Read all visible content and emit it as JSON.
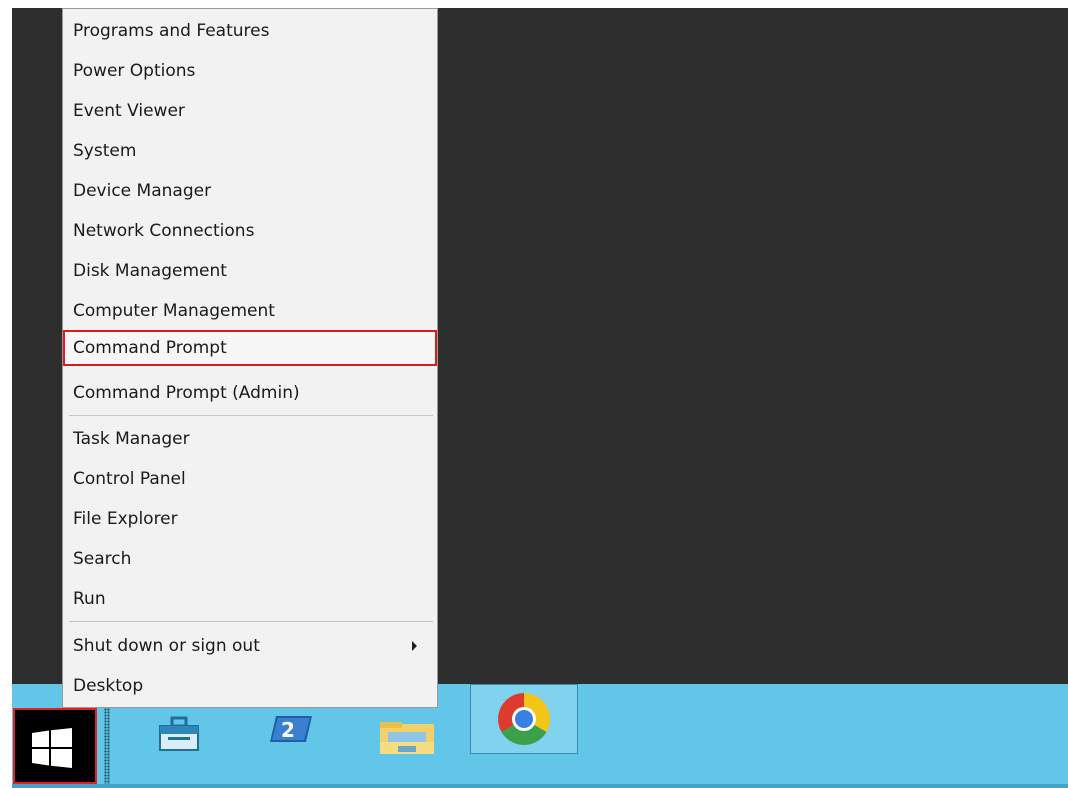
{
  "context_menu": {
    "items": [
      {
        "label": "Programs and Features"
      },
      {
        "label": "Power Options"
      },
      {
        "label": "Event Viewer"
      },
      {
        "label": "System"
      },
      {
        "label": "Device Manager"
      },
      {
        "label": "Network Connections"
      },
      {
        "label": "Disk Management"
      },
      {
        "label": "Computer Management"
      },
      {
        "label": "Command Prompt",
        "highlighted": true
      },
      {
        "label": "Command Prompt (Admin)"
      },
      {
        "label": "Task Manager"
      },
      {
        "label": "Control Panel"
      },
      {
        "label": "File Explorer"
      },
      {
        "label": "Search"
      },
      {
        "label": "Run"
      },
      {
        "label": "Shut down or sign out",
        "submenu": true
      },
      {
        "label": "Desktop"
      }
    ]
  },
  "taskbar": {
    "start_button": {
      "icon": "windows-logo-icon",
      "highlighted": true,
      "highlight_color": "#e32020"
    },
    "pinned_apps": [
      {
        "icon": "server-manager-icon"
      },
      {
        "icon": "powershell-icon"
      },
      {
        "icon": "file-explorer-icon"
      },
      {
        "icon": "chrome-icon",
        "active": true
      }
    ]
  },
  "colors": {
    "desktop": "#2e2e2e",
    "taskbar": "#62c6e8",
    "menu_background": "#f2f2f2",
    "highlight_border": "#d81c1c"
  }
}
